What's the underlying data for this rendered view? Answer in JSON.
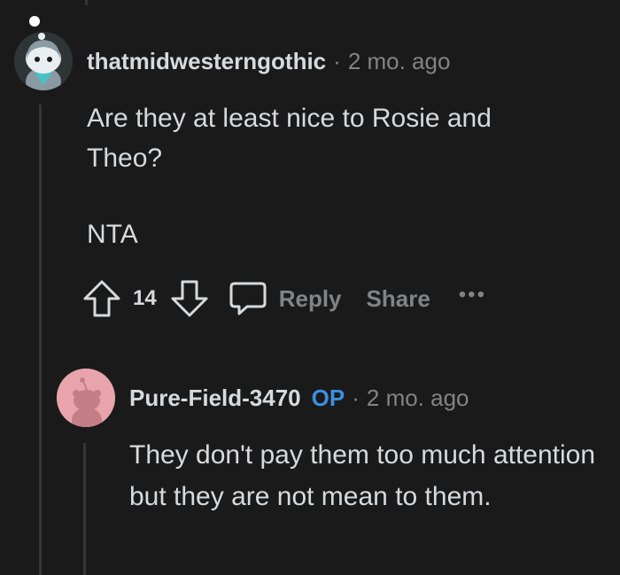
{
  "comment": {
    "author": "thatmidwesterngothic",
    "separator": "·",
    "time": "2 mo. ago",
    "body": [
      "Are they at least nice to Rosie and Theo?",
      "NTA"
    ],
    "votes": "14",
    "reply_label": "Reply",
    "share_label": "Share",
    "more_label": "•••"
  },
  "reply": {
    "author": "Pure-Field-3470",
    "op_badge": "OP",
    "separator": "·",
    "time": "2 mo. ago",
    "body": "They don't pay them too much attention but they are not mean to them."
  },
  "colors": {
    "background": "#1a1a1b",
    "text": "#d7dadc",
    "muted": "#818384",
    "op_blue": "#3d8fe0",
    "avatar1_bg": "#2f3437",
    "avatar2_bg": "#e8a4ab"
  }
}
